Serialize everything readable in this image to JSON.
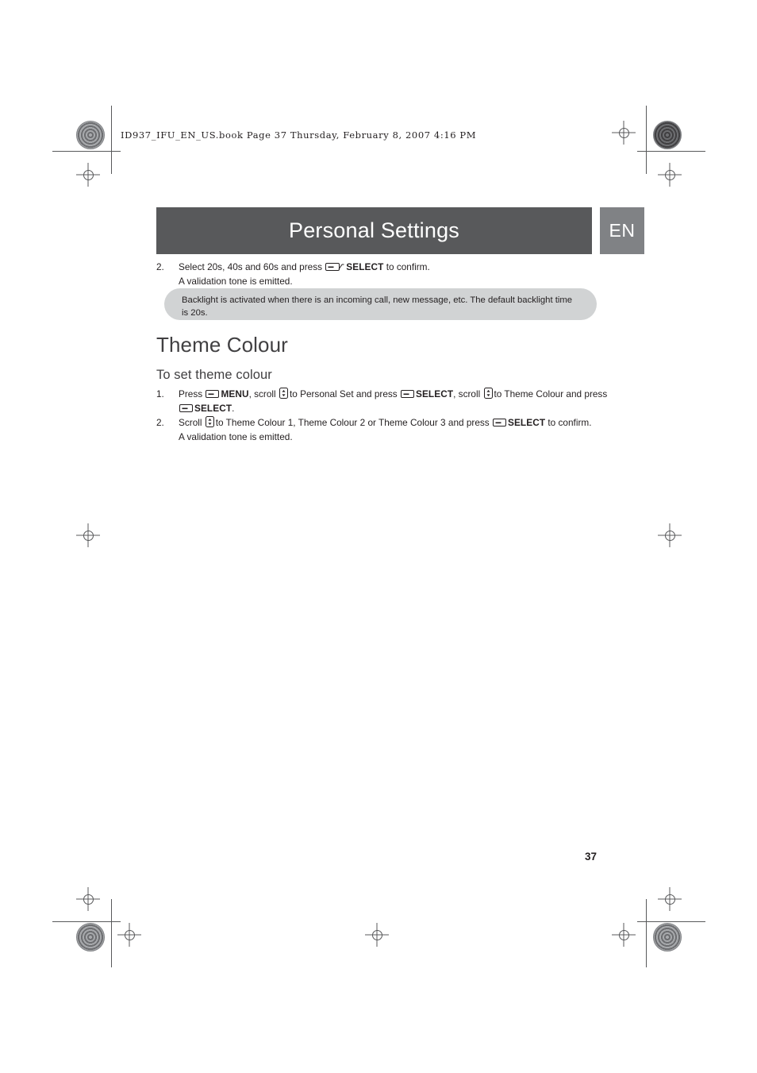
{
  "document": {
    "file_header": "ID937_IFU_EN_US.book  Page 37  Thursday, February 8, 2007  4:16 PM",
    "title": "Personal Settings",
    "language_tag": "EN",
    "page_number": "37"
  },
  "top_step": {
    "number": "2.",
    "text_before_key": "Select 20s, 40s and 60s and press",
    "key_label": "SELECT",
    "text_after_key": "to confirm.",
    "sub_line": "A validation tone is emitted."
  },
  "note": {
    "text": "Backlight is activated when there is an incoming call, new message, etc. The default backlight time is 20s."
  },
  "section": {
    "heading": "Theme Colour",
    "subheading": "To set theme colour"
  },
  "steps": [
    {
      "number": "1.",
      "parts": [
        {
          "type": "text",
          "value": "Press"
        },
        {
          "type": "key",
          "icon": "soft-key-icon"
        },
        {
          "type": "bold",
          "value": "MENU"
        },
        {
          "type": "text",
          "value": ", scroll"
        },
        {
          "type": "key",
          "icon": "scroll-key-icon"
        },
        {
          "type": "text",
          "value": "to Personal Set and press"
        },
        {
          "type": "key",
          "icon": "soft-key-icon"
        },
        {
          "type": "bold",
          "value": "SELECT"
        },
        {
          "type": "text",
          "value": ", scroll"
        },
        {
          "type": "key",
          "icon": "scroll-key-icon"
        },
        {
          "type": "text",
          "value": "to Theme Colour and press"
        },
        {
          "type": "key",
          "icon": "soft-key-icon"
        },
        {
          "type": "bold",
          "value": "SELECT"
        },
        {
          "type": "text",
          "value": "."
        }
      ],
      "line1_text": "Press",
      "line1_menu": "MENU",
      "line1_a": ", scroll",
      "line1_b": "to Personal Set and press",
      "line1_select1": "SELECT",
      "line1_c": ", scroll",
      "line1_d": "to Theme Colour and press",
      "line2_select2": "SELECT",
      "line2_end": "."
    },
    {
      "number": "2.",
      "text_before_scroll": "Scroll",
      "text_after_scroll": "to Theme Colour 1, Theme Colour 2 or Theme Colour 3 and press",
      "key_label": "SELECT",
      "text_end": "to confirm.",
      "sub_line": "A validation tone is emitted."
    }
  ],
  "colors": {
    "title_bar": "#58595b",
    "lang_box": "#808285",
    "note_bg": "#d1d3d4",
    "heading": "#414042",
    "text": "#231f20"
  }
}
